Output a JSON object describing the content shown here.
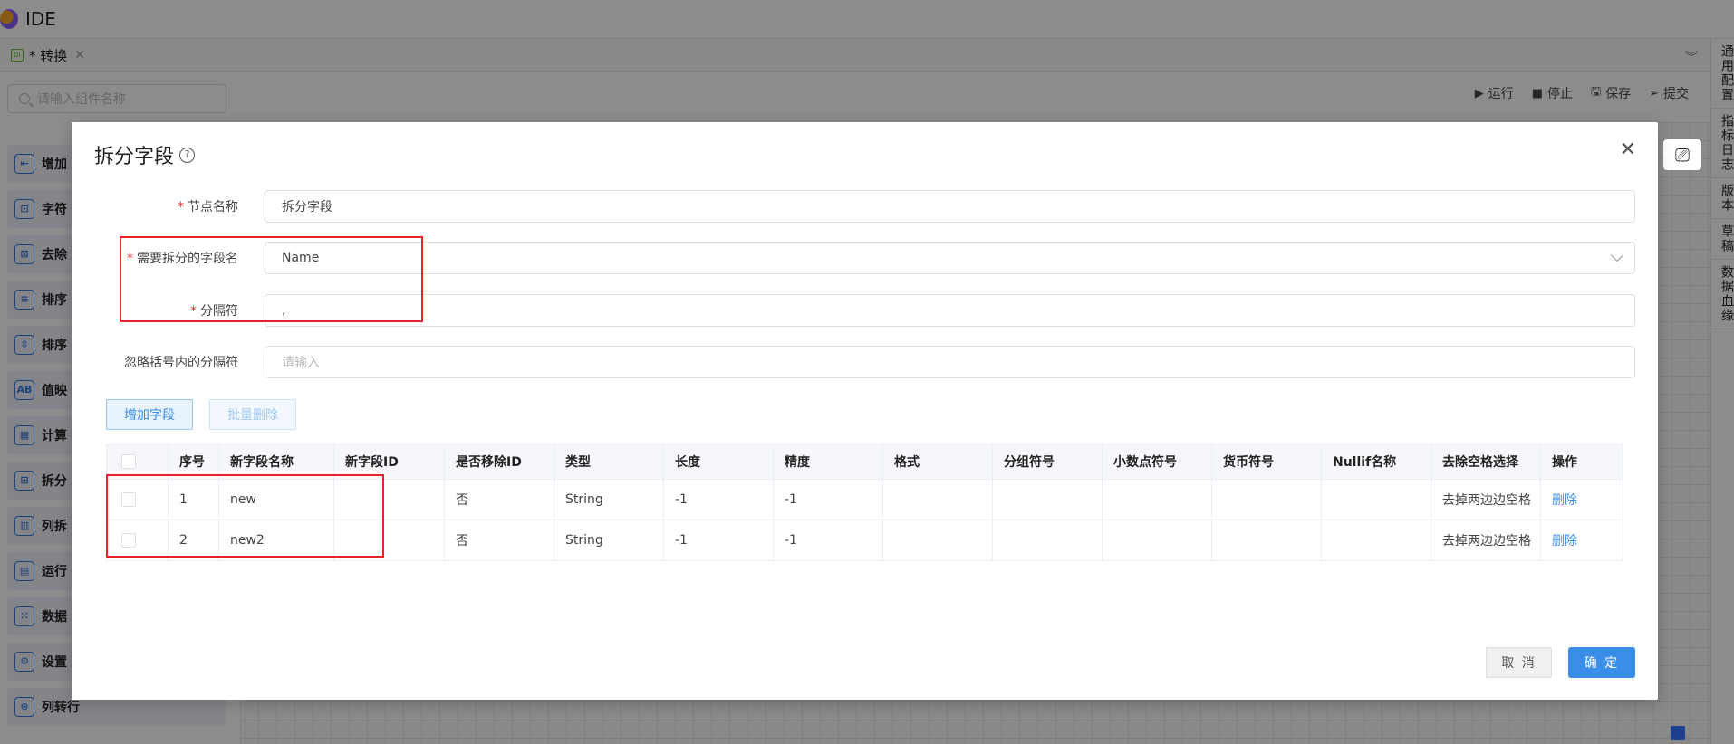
{
  "app": {
    "title": "IDE"
  },
  "tabs": [
    {
      "icon": "DI",
      "label": "* 转换"
    }
  ],
  "sidebar": {
    "search_placeholder": "请输入组件名称",
    "items": [
      {
        "icon": "⇤",
        "label": "增加"
      },
      {
        "icon": "⊡",
        "label": "字符"
      },
      {
        "icon": "⊠",
        "label": "去除"
      },
      {
        "icon": "≡",
        "label": "排序"
      },
      {
        "icon": "⇳",
        "label": "排序"
      },
      {
        "icon": "AB",
        "label": "值映"
      },
      {
        "icon": "▦",
        "label": "计算"
      },
      {
        "icon": "⊞",
        "label": "拆分"
      },
      {
        "icon": "▥",
        "label": "列拆"
      },
      {
        "icon": "▤",
        "label": "运行"
      },
      {
        "icon": "⁙",
        "label": "数据"
      },
      {
        "icon": "⚙",
        "label": "设置"
      },
      {
        "icon": "⊕",
        "label": "列转行"
      }
    ]
  },
  "toolbar": {
    "run": "运行",
    "stop": "停止",
    "save": "保存",
    "submit": "提交"
  },
  "right_rail": {
    "items": [
      "通用配置",
      "指标日志",
      "版本",
      "草稿",
      "数据血缘"
    ]
  },
  "modal": {
    "title": "拆分字段",
    "fields": {
      "node_name": {
        "label": "节点名称",
        "required": "*",
        "value": "拆分字段"
      },
      "split_field": {
        "label": "需要拆分的字段名",
        "required": "*",
        "value": "Name"
      },
      "delimiter": {
        "label": "分隔符",
        "required": "*",
        "value": ","
      },
      "ignore_in_brackets": {
        "label": "忽略括号内的分隔符",
        "placeholder": "请输入"
      }
    },
    "buttons": {
      "add_field": "增加字段",
      "batch_delete": "批量删除",
      "cancel": "取 消",
      "confirm": "确 定"
    },
    "table": {
      "headers": [
        "序号",
        "新字段名称",
        "新字段ID",
        "是否移除ID",
        "类型",
        "长度",
        "精度",
        "格式",
        "分组符号",
        "小数点符号",
        "货币符号",
        "Nullif名称",
        "去除空格选择",
        "操作"
      ],
      "rows": [
        [
          "1",
          "new",
          "",
          "否",
          "String",
          "-1",
          "-1",
          "",
          "",
          "",
          "",
          "",
          "去掉两边边空格",
          "删除"
        ],
        [
          "2",
          "new2",
          "",
          "否",
          "String",
          "-1",
          "-1",
          "",
          "",
          "",
          "",
          "",
          "去掉两边边空格",
          "删除"
        ]
      ]
    }
  }
}
